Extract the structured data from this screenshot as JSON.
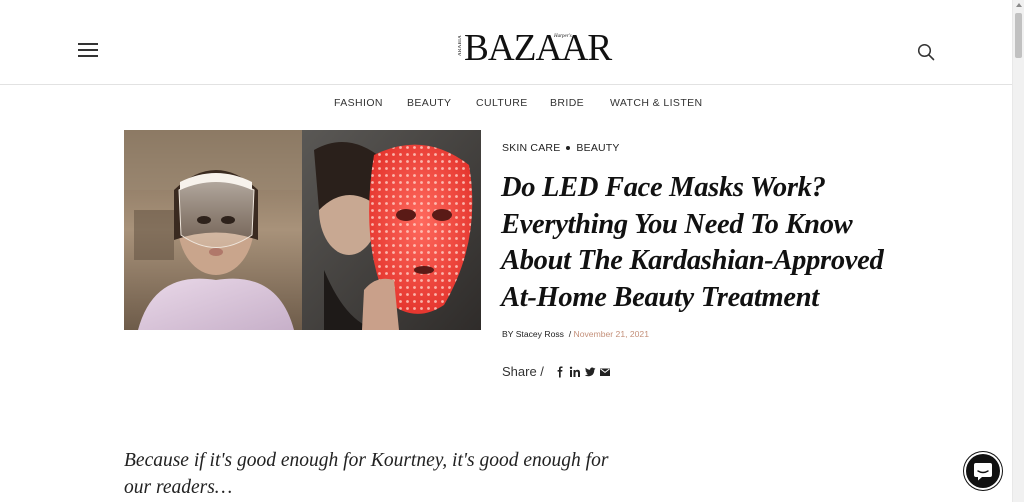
{
  "header": {
    "logo_main": "BAZAAR",
    "logo_sub": "ARABIA",
    "logo_tag": "Harper's"
  },
  "nav": {
    "items": [
      {
        "label": "FASHION"
      },
      {
        "label": "BEAUTY"
      },
      {
        "label": "CULTURE"
      },
      {
        "label": "BRIDE"
      },
      {
        "label": "WATCH & LISTEN"
      }
    ]
  },
  "article": {
    "categories": [
      "SKIN CARE",
      "BEAUTY"
    ],
    "title": "Do LED Face Masks Work? Everything You Need To Know About The Kardashian-Approved At-Home Beauty Treatment",
    "byline_prefix": "BY",
    "author": "Stacey Ross",
    "separator": "/",
    "date": "November 21, 2021",
    "share_label": "Share /",
    "share_icons": [
      "facebook-icon",
      "linkedin-icon",
      "twitter-icon",
      "email-icon"
    ],
    "dek": "Because if it's good enough for Kourtney, it's good enough for our readers…"
  },
  "colors": {
    "date": "#c4907a",
    "text": "#222222",
    "divider": "#e2e2e2",
    "led_red": "#f0453e"
  },
  "icons": {
    "menu": "hamburger-menu-icon",
    "search": "search-icon",
    "chat": "chat-icon"
  }
}
